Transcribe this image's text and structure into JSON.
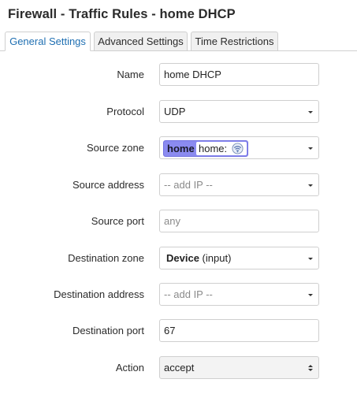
{
  "title": "Firewall - Traffic Rules - home DHCP",
  "tabs": [
    {
      "label": "General Settings",
      "active": true
    },
    {
      "label": "Advanced Settings",
      "active": false
    },
    {
      "label": "Time Restrictions",
      "active": false
    }
  ],
  "fields": {
    "name": {
      "label": "Name",
      "value": "home DHCP"
    },
    "protocol": {
      "label": "Protocol",
      "value": "UDP"
    },
    "source_zone": {
      "label": "Source zone",
      "zone": "home",
      "network": "home:"
    },
    "source_address": {
      "label": "Source address",
      "placeholder": "-- add IP --"
    },
    "source_port": {
      "label": "Source port",
      "placeholder": "any"
    },
    "destination_zone": {
      "label": "Destination zone",
      "zone": "Device",
      "detail": "(input)"
    },
    "destination_address": {
      "label": "Destination address",
      "placeholder": "-- add IP --"
    },
    "destination_port": {
      "label": "Destination port",
      "value": "67"
    },
    "action": {
      "label": "Action",
      "value": "accept"
    }
  },
  "colors": {
    "accent": "#1f6fb2",
    "zone_home": "#8b8bf0"
  },
  "icons": {
    "dropdown": "chevron-down-icon",
    "spinner": "up-down-arrows-icon",
    "wireless": "wifi-icon"
  }
}
